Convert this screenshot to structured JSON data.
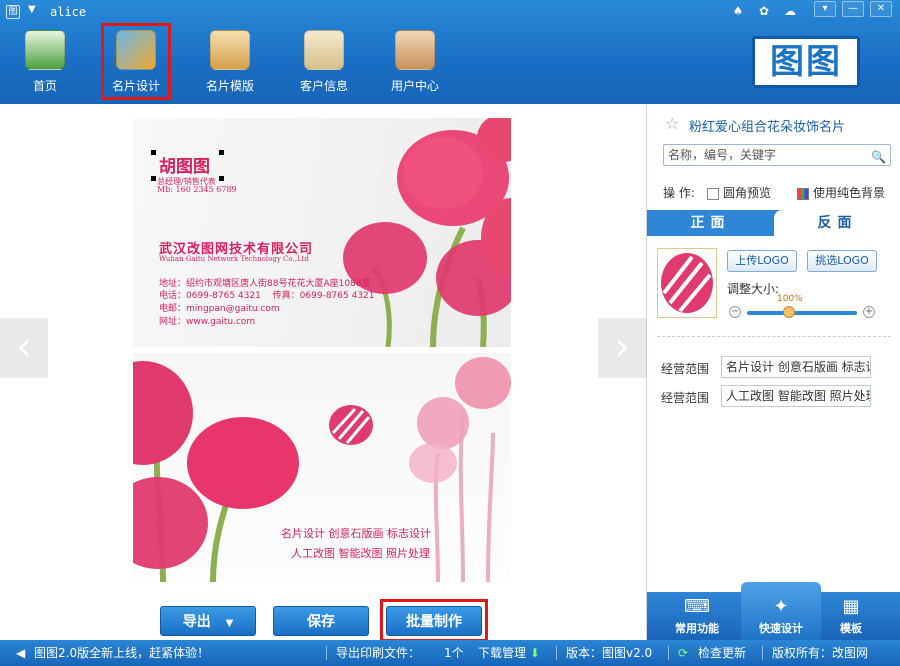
{
  "app": {
    "user": "alice",
    "icons": [
      "app-logo-icon",
      "menu-arrow-icon",
      "bell-icon",
      "gear-icon",
      "chat-icon",
      "dropdown-icon",
      "minimize-icon",
      "close-icon"
    ]
  },
  "nav": [
    {
      "label": "首页",
      "icon": "home-icon",
      "color": "#4c9f3f"
    },
    {
      "label": "名片设计",
      "icon": "design-icon",
      "color": "#f0a830",
      "active": true
    },
    {
      "label": "名片模版",
      "icon": "template-icon",
      "color": "#d5a04a"
    },
    {
      "label": "客户信息",
      "icon": "customer-icon",
      "color": "#d7c08a"
    },
    {
      "label": "用户中心",
      "icon": "user-center-icon",
      "color": "#c89058"
    }
  ],
  "brand": {
    "logo_text": "图图"
  },
  "card_front": {
    "name": "胡图图",
    "title": "总经理/销售代表",
    "mobile": "Mb: 160 2345 6789",
    "company": "武汉改图网技术有限公司",
    "company_en": "Wuhan Gaitu Network Technology Co.,Ltd",
    "address": "地址：绍约市观塘区唐人街88号花花大厦A座1088室",
    "phone": "电话：0699-8765 4321　 传真：0699-8765 4321",
    "email": "电邮：mingpan@gaitu.com",
    "website": "网址：www.gaitu.com"
  },
  "card_back": {
    "line1": "名片设计  创意石版画  标志设计",
    "line2": "人工改图  智能改图  照片处理"
  },
  "actions": {
    "export": "导出",
    "save": "保存",
    "batch": "批量制作"
  },
  "panel": {
    "card_title": "粉红爱心组合花朵妆饰名片",
    "search_placeholder": "名称，编号，关键字",
    "op_label": "操 作:",
    "rounded_preview": "圆角预览",
    "solid_bg": "使用纯色背景",
    "tab_front": "正面",
    "tab_back": "反面",
    "upload_logo": "上传LOGO",
    "pick_logo": "挑选LOGO",
    "size_label": "调整大小:",
    "size_pct": "100%",
    "biz_label_1": "经营范围",
    "biz_value_1": "名片设计  创意石版画  标志设计",
    "biz_label_2": "经营范围",
    "biz_value_2": "人工改图  智能改图  照片处理",
    "bottom": [
      "常用功能",
      "快速设计",
      "模板"
    ]
  },
  "status": {
    "news": "图图2.0版全新上线，赶紧体验！",
    "export_files_label": "导出印刷文件：",
    "export_files_count": "1个",
    "download": "下载管理",
    "version": "版本：图图v2.0",
    "update": "检查更新",
    "copyright": "版权所有：改图网"
  },
  "colors": {
    "accent": "#1a6fc4",
    "highlight": "#e01818",
    "pink": "#d8205f"
  }
}
